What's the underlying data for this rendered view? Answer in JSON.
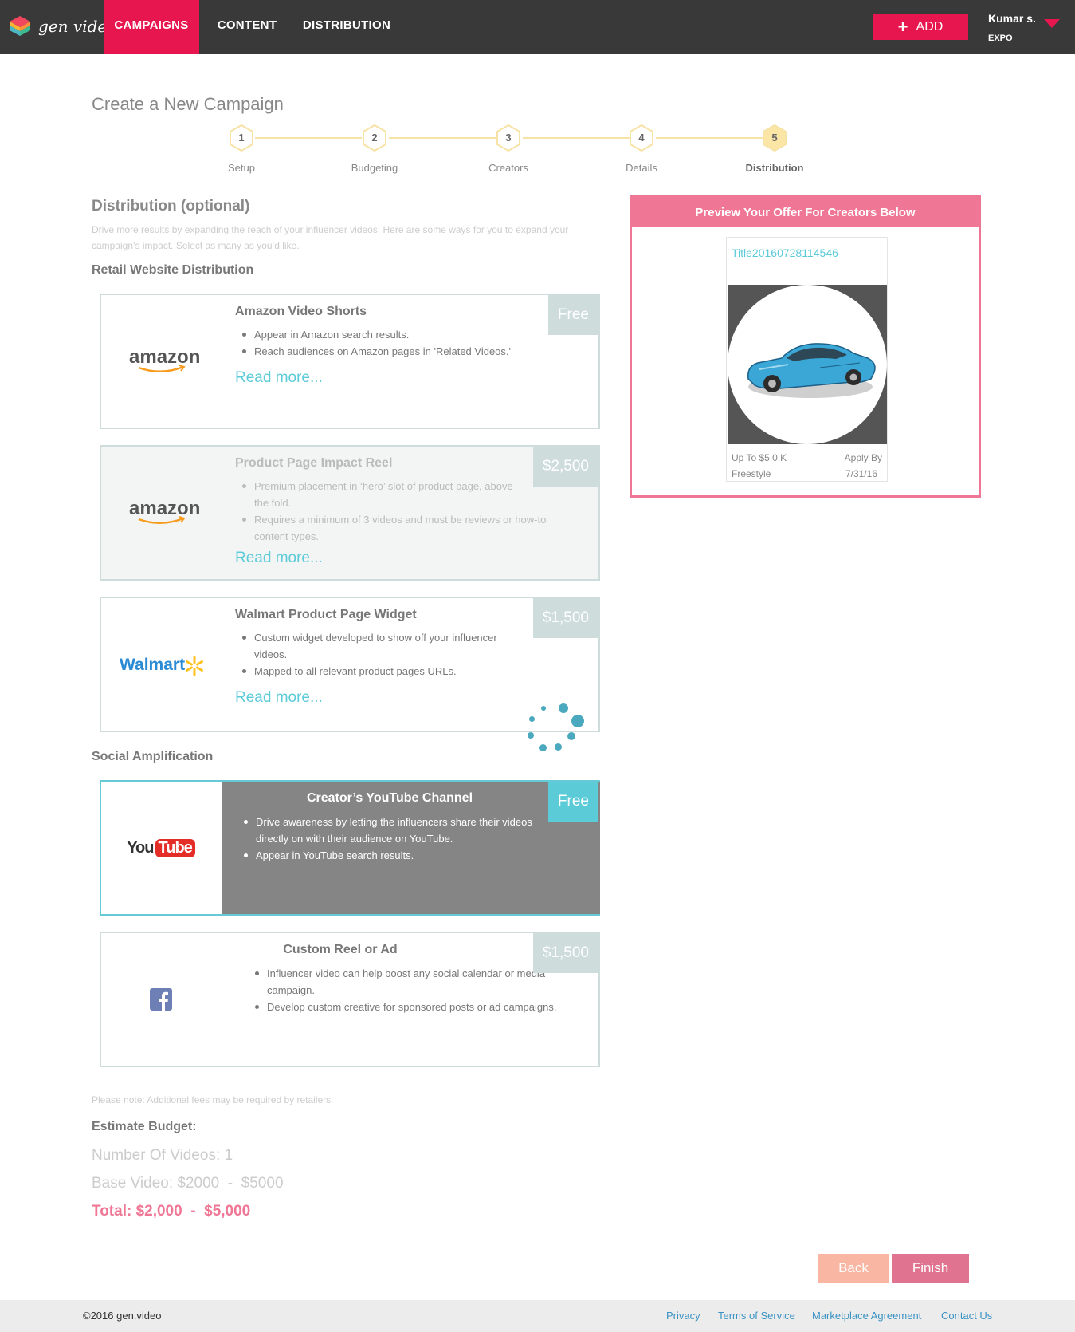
{
  "brand": {
    "name": "gen video",
    "accent": "#e8164f",
    "teal": "#5ccbd8",
    "pink": "#ef7694"
  },
  "nav": {
    "items": [
      {
        "label": "CAMPAIGNS",
        "active": true
      },
      {
        "label": "CONTENT",
        "active": false
      },
      {
        "label": "DISTRIBUTION",
        "active": false
      }
    ],
    "add_label": "ADD",
    "add_icon": "plus-icon",
    "user": {
      "name": "Kumar s.",
      "org": "EXPO"
    }
  },
  "page": {
    "title": "Create a New Campaign"
  },
  "steps": [
    {
      "number": "1",
      "label": "Setup",
      "active": false
    },
    {
      "number": "2",
      "label": "Budgeting",
      "active": false
    },
    {
      "number": "3",
      "label": "Creators",
      "active": false
    },
    {
      "number": "4",
      "label": "Details",
      "active": false
    },
    {
      "number": "5",
      "label": "Distribution",
      "active": true
    }
  ],
  "distribution": {
    "heading": "Distribution (optional)",
    "intro": "Drive more results by expanding the reach of your influencer videos! Here are some ways for you to expand your campaign’s impact. Select as many as you’d like.",
    "retail_heading": "Retail Website Distribution",
    "social_heading": "Social Amplification",
    "read_more": "Read more...",
    "cards": [
      {
        "logo": "amazon",
        "title": "Amazon Video Shorts",
        "price": "Free",
        "bullets": [
          "Appear in Amazon search results.",
          "Reach audiences on Amazon pages in 'Related Videos.'"
        ]
      },
      {
        "logo": "amazon",
        "title": "Product Page Impact Reel",
        "price": "$2,500",
        "disabled": true,
        "bullets": [
          "Premium placement in ‘hero’ slot of product page, above the fold.",
          "Requires a minimum of 3 videos and must be reviews or how-to content types."
        ]
      },
      {
        "logo": "Walmart",
        "title": "Walmart Product Page Widget",
        "price": "$1,500",
        "bullets": [
          "Custom widget developed to show off your influencer videos.",
          "Mapped to all relevant product pages URLs."
        ]
      },
      {
        "logo": "YouTube",
        "logo_parts": [
          "You",
          "Tube"
        ],
        "title": "Creator’s YouTube Channel",
        "price": "Free",
        "selected": true,
        "bullets": [
          "Drive awareness by letting the influencers share their videos directly on with their audience on YouTube.",
          "Appear in YouTube search results."
        ]
      },
      {
        "logo": "facebook-icon",
        "title": "Custom Reel or Ad",
        "price": "$1,500",
        "bullets": [
          "Influencer video can help boost any social calendar or media campaign.",
          "Develop custom creative for sponsored posts or ad campaigns."
        ]
      }
    ]
  },
  "preview": {
    "heading": "Preview Your Offer For Creators Below",
    "offer_title": "Title20160728114546",
    "image": "blue-car-image",
    "budget": "Up To $5.0 K",
    "type": "Freestyle",
    "apply_label": "Apply By",
    "apply_date": "7/31/16"
  },
  "budget": {
    "note": "Please note: Additional fees may be required by retailers.",
    "heading": "Estimate Budget:",
    "videos": "Number Of Videos: 1",
    "base": "Base Video: $2000  -  $5000",
    "total": "Total: $2,000  -  $5,000"
  },
  "actions": {
    "back": "Back",
    "finish": "Finish"
  },
  "footer": {
    "copyright": "©2016 gen.video",
    "links": [
      "Privacy",
      "Terms of Service",
      "Marketplace Agreement",
      "Contact Us"
    ]
  }
}
